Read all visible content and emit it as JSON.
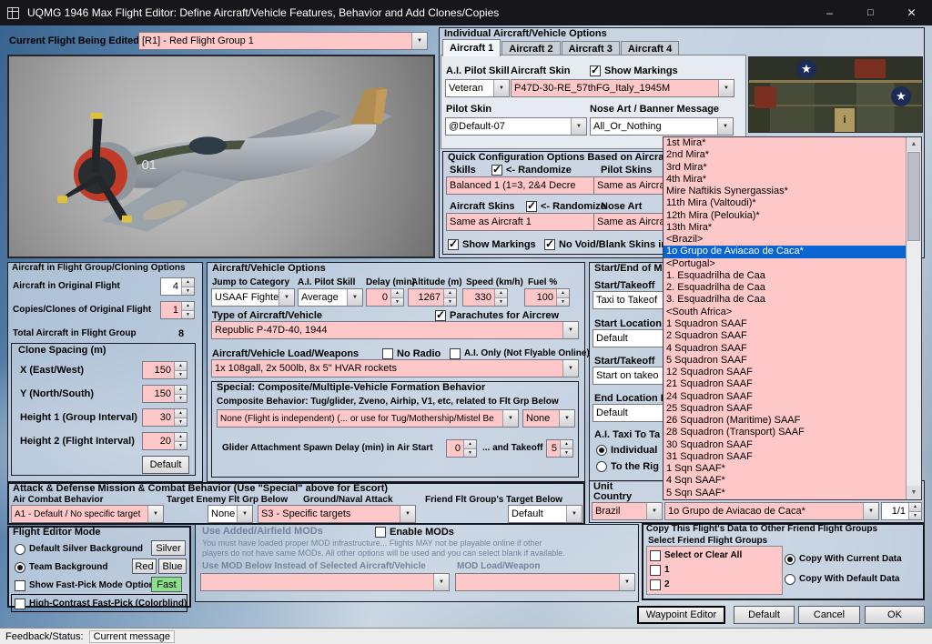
{
  "titlebar": {
    "title": "UQMG 1946 Max Flight Editor:  Define Aircraft/Vehicle Features, Behavior and Add Clones/Copies"
  },
  "colors": {
    "input_pink": "#ffc8c8",
    "selection_blue": "#0a64d2",
    "fast_green": "#8ae08a"
  },
  "current_flight": {
    "label": "Current Flight Being Edited:",
    "value": "[R1] -  Red Flight Group  1"
  },
  "preview": {
    "plane_number": "01"
  },
  "skin_preview": {
    "marking": "i"
  },
  "individual_options": {
    "title": "Individual Aircraft/Vehicle Options",
    "tabs": [
      "Aircraft 1",
      "Aircraft 2",
      "Aircraft 3",
      "Aircraft 4"
    ],
    "selected_tab_index": 0,
    "ai_pilot_skill_label": "A.I. Pilot Skill",
    "aircraft_skin_label": "Aircraft Skin",
    "show_markings_label": "Show Markings",
    "ai_pilot_skill_value": "Veteran",
    "aircraft_skin_value": "P47D-30-RE_57thFG_Italy_1945M",
    "pilot_skin_label": "Pilot Skin",
    "nose_art_label": "Nose Art / Banner Message",
    "pilot_skin_value": "@Default-07",
    "nose_art_value": "All_Or_Nothing"
  },
  "quick_config": {
    "title": "Quick Configuration Options Based on Aircraft 1",
    "skills_label": "Skills",
    "randomize_label": "<- Randomize",
    "pilot_skins_label": "Pilot Skins",
    "skills_value": "Balanced 1 (1=3, 2&4 Decre",
    "pilot_skins_value": "Same as Aircra",
    "aircraft_skins_label": "Aircraft Skins",
    "randomize2_label": "<- Randomize",
    "nose_art_label": "Nose Art",
    "aircraft_skins_value": "Same as Aircraft 1",
    "nose_art_value": "Same as Aircra",
    "show_markings_label": "Show Markings",
    "no_void_label": "No Void/Blank Skins in Ran"
  },
  "unit_dropdown": {
    "selected_index": 9,
    "items": [
      "1st Mira*",
      "2nd Mira*",
      "3rd Mira*",
      "4th Mira*",
      "Mire Naftikis Synergassias*",
      "11th Mira (Valtoudi)*",
      "12th Mira (Peloukia)*",
      "13th Mira*",
      "<Brazil>",
      "1o Grupo de Aviacao de Caca*",
      "<Portugal>",
      "1. Esquadrilha de Caa",
      "2. Esquadrilha de Caa",
      "3. Esquadrilha de Caa",
      "<South Africa>",
      "1 Squadron SAAF",
      "2 Squadron SAAF",
      "4 Squadron SAAF",
      "5 Squadron SAAF",
      "12 Squadron SAAF",
      "21 Squadron SAAF",
      "24 Squadron SAAF",
      "25 Squadron SAAF",
      "26 Squadron (Maritime) SAAF",
      "28 Squadron (Transport) SAAF",
      "30 Squadron SAAF",
      "31 Squadron SAAF",
      "1 Sqn SAAF*",
      "4 Sqn SAAF*",
      "5 Sqn SAAF*"
    ]
  },
  "cloning": {
    "title": "Aircraft in Flight Group/Cloning Options",
    "original_label": "Aircraft in Original Flight",
    "original_value": "4",
    "copies_label": "Copies/Clones of Original Flight",
    "copies_value": "1",
    "total_label": "Total Aircraft in Flight Group",
    "total_value": "8",
    "spacing_title": "Clone Spacing (m)",
    "x_label": "X (East/West)",
    "x_value": "150",
    "y_label": "Y (North/South)",
    "y_value": "150",
    "h1_label": "Height 1 (Group Interval)",
    "h1_value": "30",
    "h2_label": "Height 2 (Flight Interval)",
    "h2_value": "20",
    "default_button": "Default"
  },
  "vehicle": {
    "title": "Aircraft/Vehicle Options",
    "jump_label": "Jump to Category",
    "skill_label": "A.I. Pilot Skill",
    "delay_label": "Delay (min)",
    "altitude_label": "Altitude (m)",
    "speed_label": "Speed (km/h)",
    "fuel_label": "Fuel %",
    "jump_value": "USAAF Fighter",
    "skill_value": "Average",
    "delay_value": "0",
    "altitude_value": "1267",
    "speed_value": "330",
    "fuel_value": "100",
    "type_label": "Type of Aircraft/Vehicle",
    "parachutes_label": "Parachutes for Aircrew",
    "type_value": "Republic P-47D-40, 1944",
    "load_label": "Aircraft/Vehicle Load/Weapons",
    "no_radio_label": "No Radio",
    "ai_only_label": "A.I. Only (Not Flyable Online)",
    "load_value": "1x 108gall, 2x 500lb, 8x 5\" HVAR rockets",
    "special_title": "Special: Composite/Multiple-Vehicle Formation Behavior",
    "composite_label": "Composite Behavior: Tug/glider, Zveno, Airhip, V1, etc, related to Flt Grp Below",
    "composite_value": "None (Flight is independent) (... or use for Tug/Mothership/Mistel Be",
    "composite_value2": "None",
    "glider_label": "Glider Attachment Spawn Delay (min) in Air Start",
    "glider_value": "0",
    "takeoff_label": "... and Takeoff",
    "takeoff_value": "5"
  },
  "start_end": {
    "title": "Start/End of M",
    "start_takeoff_label": "Start/Takeoff",
    "taxi_value": "Taxi to Takeof",
    "start_location_label": "Start Location",
    "start_location_value": "Default",
    "start_takeoff2_label": "Start/Takeoff",
    "start_on_takeoff_value": "Start on takeo",
    "end_location_label": "End Location B",
    "end_location_value": "Default",
    "ai_taxi_label": "A.I. Taxi To Ta",
    "individual_label": "Individual",
    "to_right_label": "To the Rig"
  },
  "attack": {
    "title": "Attack & Defense Mission & Combat Behavior (Use \"Special\" above for Escort)",
    "air_combat_label": "Air Combat Behavior",
    "target_enemy_label": "Target Enemy Flt Grp Below",
    "ground_label": "Ground/Naval Attack",
    "friend_label": "Friend Flt Group's Target Below",
    "air_combat_value": "A1 - Default / No specific target",
    "target_enemy_value": "None",
    "ground_value": "S3 - Specific targets",
    "friend_value": "Default"
  },
  "unit_country": {
    "unit_label": "Unit",
    "country_label": "Country",
    "country_value": "Brazil",
    "unit_value": "1o Grupo de Aviacao de Caca*",
    "counter_value": "1/1"
  },
  "editor_mode": {
    "title": "Flight Editor Mode",
    "silver_label": "Default Silver Background",
    "silver_button": "Silver",
    "team_label": "Team Background",
    "red_button": "Red",
    "blue_button": "Blue",
    "fastpick_label": "Show Fast-Pick Mode Options",
    "fast_button": "Fast",
    "contrast_label": "High-Contrast Fast-Pick (Colorblind)"
  },
  "mods": {
    "title": "Use Added/Airfield MODs",
    "enable_label": "Enable MODs",
    "warning1": "You must have loaded proper MOD infrastructure...  Flights MAY not be playable online if other",
    "warning2": "players do not have same MODs.  All other options will be used and you can select blank if available.",
    "use_mod_label": "Use MOD Below Instead of Selected Aircraft/Vehicle",
    "mod_load_label": "MOD Load/Weapon",
    "mod_value": "",
    "mod_load_value": ""
  },
  "copy_panel": {
    "title": "Copy This Flight's Data to Other Friend Flight Groups",
    "select_label": "Select Friend Flight Groups",
    "select_all_label": "Select or Clear All",
    "group1_label": "1",
    "group2_label": "2",
    "copy_current_label": "Copy With Current Data",
    "copy_default_label": "Copy With Default Data"
  },
  "buttons": {
    "waypoint": "Waypoint Editor",
    "default": "Default",
    "cancel": "Cancel",
    "ok": "OK"
  },
  "statusbar": {
    "label": "Feedback/Status:",
    "message": "Current message"
  }
}
